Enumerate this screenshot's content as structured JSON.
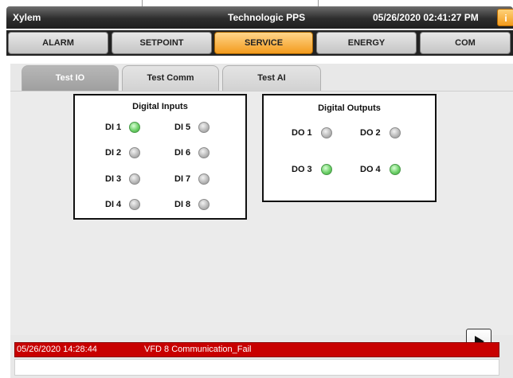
{
  "titlebar": {
    "app_name": "Xylem",
    "center_title": "Technologic PPS",
    "datetime": "05/26/2020 02:41:27 PM",
    "info_icon": "i"
  },
  "mainnav": {
    "items": [
      {
        "label": "ALARM",
        "active": false
      },
      {
        "label": "SETPOINT",
        "active": false
      },
      {
        "label": "SERVICE",
        "active": true
      },
      {
        "label": "ENERGY",
        "active": false
      },
      {
        "label": "COM",
        "active": false
      }
    ]
  },
  "subtabs": [
    {
      "label": "Test IO",
      "active": true
    },
    {
      "label": "Test Comm",
      "active": false
    },
    {
      "label": "Test AI",
      "active": false
    }
  ],
  "digital_inputs": {
    "title": "Digital Inputs",
    "items": [
      {
        "label": "DI 1",
        "on": true
      },
      {
        "label": "DI 2",
        "on": false
      },
      {
        "label": "DI 3",
        "on": false
      },
      {
        "label": "DI 4",
        "on": false
      },
      {
        "label": "DI 5",
        "on": false
      },
      {
        "label": "DI 6",
        "on": false
      },
      {
        "label": "DI 7",
        "on": false
      },
      {
        "label": "DI 8",
        "on": false
      }
    ]
  },
  "digital_outputs": {
    "title": "Digital Outputs",
    "items": [
      {
        "label": "DO 1",
        "on": false
      },
      {
        "label": "DO 2",
        "on": false
      },
      {
        "label": "DO 3",
        "on": true
      },
      {
        "label": "DO 4",
        "on": true
      }
    ]
  },
  "alarm_bar": {
    "timestamp": "05/26/2020 14:28:44",
    "message": "VFD 8 Communication_Fail"
  },
  "colors": {
    "accent_active": "#f39b1e",
    "alarm_red": "#c80000",
    "led_on": "#6fd16a",
    "led_off": "#b5b5b5"
  },
  "icons": {
    "info": "info-icon",
    "next": "play-right-icon"
  }
}
